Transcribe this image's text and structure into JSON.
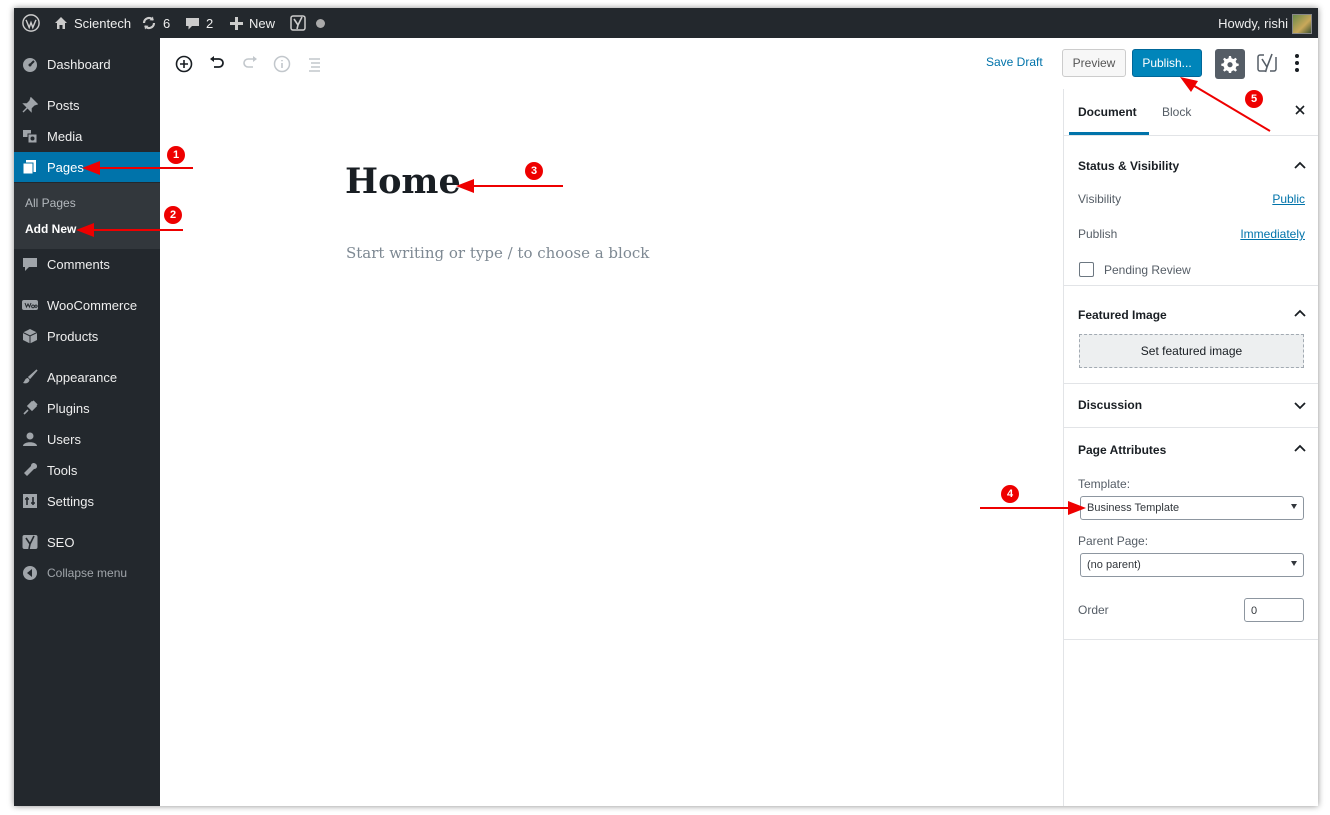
{
  "admin_bar": {
    "site_name": "Scientech",
    "updates_count": "6",
    "comments_count": "2",
    "new_label": "New",
    "howdy": "Howdy, rishi"
  },
  "sidebar": {
    "items": [
      {
        "label": "Dashboard",
        "icon": "dashboard-icon"
      },
      {
        "label": "Posts",
        "icon": "pin-icon"
      },
      {
        "label": "Media",
        "icon": "media-icon"
      },
      {
        "label": "Pages",
        "icon": "pages-icon"
      },
      {
        "label": "Comments",
        "icon": "comment-icon"
      },
      {
        "label": "WooCommerce",
        "icon": "woocommerce-icon"
      },
      {
        "label": "Products",
        "icon": "products-icon"
      },
      {
        "label": "Appearance",
        "icon": "brush-icon"
      },
      {
        "label": "Plugins",
        "icon": "plug-icon"
      },
      {
        "label": "Users",
        "icon": "users-icon"
      },
      {
        "label": "Tools",
        "icon": "wrench-icon"
      },
      {
        "label": "Settings",
        "icon": "settings-icon"
      },
      {
        "label": "SEO",
        "icon": "yoast-icon"
      },
      {
        "label": "Collapse menu",
        "icon": "collapse-icon"
      }
    ],
    "submenu": [
      {
        "label": "All Pages"
      },
      {
        "label": "Add New"
      }
    ]
  },
  "toolbar": {
    "save_draft": "Save Draft",
    "preview": "Preview",
    "publish": "Publish..."
  },
  "editor": {
    "title": "Home",
    "placeholder": "Start writing or type / to choose a block"
  },
  "panel": {
    "tabs": [
      "Document",
      "Block"
    ],
    "status": {
      "title": "Status & Visibility",
      "visibility_label": "Visibility",
      "visibility_value": "Public",
      "publish_label": "Publish",
      "publish_value": "Immediately",
      "pending_label": "Pending Review"
    },
    "featured": {
      "title": "Featured Image",
      "button": "Set featured image"
    },
    "discussion": {
      "title": "Discussion"
    },
    "attributes": {
      "title": "Page Attributes",
      "template_label": "Template:",
      "template_value": "Business Template",
      "parent_label": "Parent Page:",
      "parent_value": "(no parent)",
      "order_label": "Order",
      "order_value": "0"
    }
  },
  "annotations": [
    "1",
    "2",
    "3",
    "4",
    "5"
  ],
  "colors": {
    "admin_dark": "#23282d",
    "active_blue": "#0073aa",
    "publish_blue": "#0085ba",
    "annotation_red": "#ee0000"
  }
}
